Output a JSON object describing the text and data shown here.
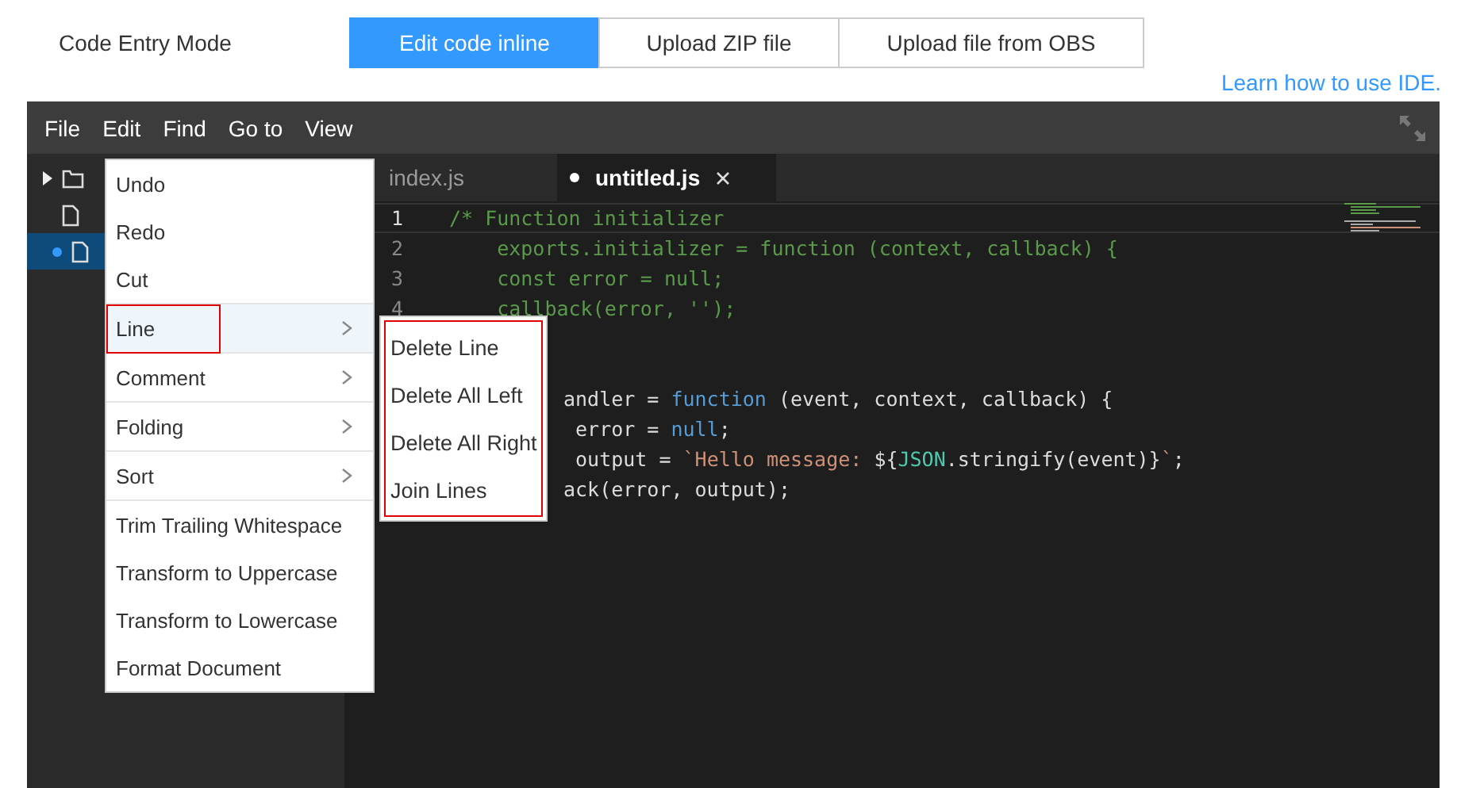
{
  "mode": {
    "label": "Code Entry Mode",
    "options": [
      {
        "label": "Edit code inline",
        "selected": true
      },
      {
        "label": "Upload ZIP file",
        "selected": false
      },
      {
        "label": "Upload file from OBS",
        "selected": false
      }
    ]
  },
  "help_link": "Learn how to use IDE.",
  "menubar": [
    "File",
    "Edit",
    "Find",
    "Go to",
    "View"
  ],
  "tabs": [
    {
      "label": "index.js",
      "selected": false,
      "modified": false
    },
    {
      "label": "untitled.js",
      "selected": true,
      "modified": true
    }
  ],
  "tree": [
    {
      "kind": "folder",
      "selected": false,
      "modified": false
    },
    {
      "kind": "file",
      "selected": false,
      "modified": false
    },
    {
      "kind": "file",
      "selected": true,
      "modified": true
    }
  ],
  "code": [
    {
      "number": "1",
      "current": true,
      "partial": false,
      "tokens": [
        {
          "kind": "comment",
          "text": "/* Function initializer"
        }
      ]
    },
    {
      "number": "2",
      "current": false,
      "partial": false,
      "tokens": [
        {
          "kind": "comment",
          "text": "    exports.initializer = function (context, callback) {"
        }
      ]
    },
    {
      "number": "3",
      "current": false,
      "partial": false,
      "tokens": [
        {
          "kind": "comment",
          "text": "    const error = null;"
        }
      ]
    },
    {
      "number": "4",
      "current": false,
      "partial": false,
      "tokens": [
        {
          "kind": "comment",
          "text": "    callback(error, '');"
        }
      ]
    },
    {
      "current": false
    },
    {
      "current": false
    },
    {
      "current": false,
      "partial": true,
      "tokens": [
        {
          "kind": "plain",
          "text": "andler = "
        },
        {
          "kind": "keyword",
          "text": "function"
        },
        {
          "kind": "plain",
          "text": " (event, context, callback) {"
        }
      ]
    },
    {
      "current": false,
      "partial": true,
      "tokens": [
        {
          "kind": "plain",
          "text": " error = "
        },
        {
          "kind": "keyword",
          "text": "null"
        },
        {
          "kind": "plain",
          "text": ";"
        }
      ]
    },
    {
      "current": false,
      "partial": true,
      "tokens": [
        {
          "kind": "plain",
          "text": " output = "
        },
        {
          "kind": "string",
          "text": "`Hello message: "
        },
        {
          "kind": "plain",
          "text": "${"
        },
        {
          "kind": "type",
          "text": "JSON"
        },
        {
          "kind": "plain",
          "text": ".stringify(event)}"
        },
        {
          "kind": "string",
          "text": "`"
        },
        {
          "kind": "plain",
          "text": ";"
        }
      ]
    },
    {
      "current": false,
      "partial": true,
      "tokens": [
        {
          "kind": "plain",
          "text": "ack(error, output);"
        }
      ]
    }
  ],
  "context_menu": [
    [
      {
        "label": "Undo",
        "submenu": false,
        "highlighted": false
      },
      {
        "label": "Redo",
        "submenu": false,
        "highlighted": false
      },
      {
        "label": "Cut",
        "submenu": false,
        "highlighted": false
      }
    ],
    [
      {
        "label": "Line",
        "submenu": true,
        "highlighted": true
      }
    ],
    [
      {
        "label": "Comment",
        "submenu": true,
        "highlighted": false
      }
    ],
    [
      {
        "label": "Folding",
        "submenu": true,
        "highlighted": false
      }
    ],
    [
      {
        "label": "Sort",
        "submenu": true,
        "highlighted": false
      }
    ],
    [
      {
        "label": "Trim Trailing Whitespace",
        "submenu": false,
        "highlighted": false
      },
      {
        "label": "Transform to Uppercase",
        "submenu": false,
        "highlighted": false
      },
      {
        "label": "Transform to Lowercase",
        "submenu": false,
        "highlighted": false
      },
      {
        "label": "Format Document",
        "submenu": false,
        "highlighted": false
      }
    ]
  ],
  "submenu": {
    "highlighted": true,
    "items": [
      "Delete Line",
      "Delete All Left",
      "Delete All Right",
      "Join Lines"
    ]
  }
}
